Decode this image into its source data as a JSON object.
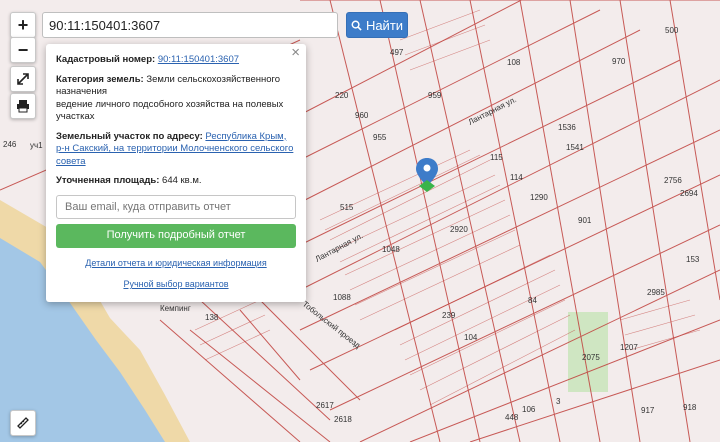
{
  "search": {
    "value": "90:11:150401:3607",
    "button_label": "Найти"
  },
  "controls": {
    "zoom_in": "+",
    "zoom_out": "−"
  },
  "popup": {
    "close": "×",
    "cadastral_label": "Кадастровый номер:",
    "cadastral_value": "90:11:150401:3607",
    "category_label": "Категория земель:",
    "category_value": "Земли сельскохозяйственного назначения",
    "use_value": "ведение личного подсобного хозяйства на полевых участках",
    "address_label": "Земельный участок по адресу:",
    "address_value": "Республика Крым, р-н Сакский, на территории Молочненского сельского совета",
    "area_label": "Уточненная площадь:",
    "area_value": "644 кв.м.",
    "email_placeholder": "Ваш email, куда отправить отчет",
    "get_report_button": "Получить подробный отчет",
    "details_link": "Детали отчета и юридическая информация",
    "manual_link": "Ручной выбор вариантов"
  },
  "map_labels": {
    "street_1": "Лантарная ул.",
    "street_2": "Лантарная ул.",
    "street_3": "Тобольский проезд",
    "place_1": "Кемпинг",
    "edge_1": "уч1",
    "edge_2": "246",
    "parcels": [
      "497",
      "500",
      "970",
      "108",
      "220",
      "960",
      "959",
      "955",
      "115",
      "114",
      "515",
      "1290",
      "2920",
      "1048",
      "901",
      "2756",
      "2694",
      "2985",
      "1088",
      "84",
      "138",
      "239",
      "104",
      "1207",
      "2075",
      "2617",
      "2618",
      "448",
      "106",
      "917",
      "918",
      "3",
      "153",
      "1541",
      "1536"
    ]
  },
  "colors": {
    "accent": "#3d7cc9",
    "green": "#5bb85e",
    "parcel_line": "#c0403c",
    "sea": "#a3c7e6",
    "beach": "#efd9a8"
  }
}
